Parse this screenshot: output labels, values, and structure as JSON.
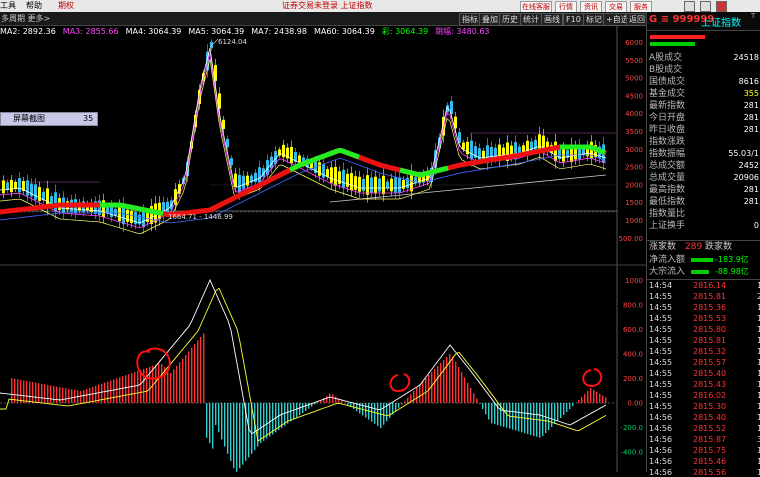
{
  "menubar": {
    "items": [
      {
        "label": "工具",
        "red": false
      },
      {
        "label": "帮助",
        "red": false
      },
      {
        "label": "期权",
        "red": true
      }
    ],
    "notice": "证券交易未登录 上证指数",
    "buttons": [
      "在线客服",
      "行情",
      "资讯",
      "交易",
      "服务"
    ]
  },
  "toolbar2": {
    "left_label": "多周期  更多>",
    "buttons": [
      "指标",
      "叠加",
      "历史",
      "统计",
      "画线",
      "F10",
      "标记",
      "+自选",
      "返回"
    ]
  },
  "ma_legend": [
    {
      "text": "MA2: 2892.36",
      "color": "#ffffff"
    },
    {
      "text": "MA3: 2855.66",
      "color": "#ff44ff"
    },
    {
      "text": "MA4: 3064.39",
      "color": "#ffffff"
    },
    {
      "text": "MA5: 3064.39",
      "color": "#ffffff"
    },
    {
      "text": "MA7: 2438.98",
      "color": "#ffffff"
    },
    {
      "text": "MA60: 3064.39",
      "color": "#ffffff"
    },
    {
      "text": "彩: 3064.39",
      "color": "#00ff00"
    },
    {
      "text": "跳幅: 3480.63",
      "color": "#ff44ff"
    }
  ],
  "tooltip": {
    "label": "屏幕截图",
    "value": "35"
  },
  "annotations": {
    "high": "6124.04",
    "low": "1664.71 - 1446.99"
  },
  "price_axis": [
    "6000",
    "5500",
    "5000",
    "4500",
    "4000",
    "3500",
    "3000",
    "2500",
    "2000",
    "1500",
    "1000",
    "500.00"
  ],
  "macd_axis": [
    "1000",
    "800.0",
    "600.0",
    "400.0",
    "200.0",
    "0.00",
    "-200.0",
    "-400.0"
  ],
  "right_panel": {
    "code": "G ≡ 999999",
    "name": "上证指数",
    "name_sup": "T",
    "stats": [
      {
        "label": "A股成交",
        "value": "24518",
        "color": "#ffffff"
      },
      {
        "label": "B股成交",
        "value": "",
        "color": "#ffffff"
      },
      {
        "label": "国债成交",
        "value": "8616",
        "color": "#ffffff"
      },
      {
        "label": "基金成交",
        "value": "355",
        "color": "#ffff00"
      },
      {
        "label": "最新指数",
        "value": "281",
        "color": "#ffffff"
      },
      {
        "label": "今日开盘",
        "value": "281",
        "color": "#ffffff"
      },
      {
        "label": "昨日收盘",
        "value": "281",
        "color": "#ffffff"
      },
      {
        "label": "指数涨跌",
        "value": "",
        "color": "#ffffff"
      },
      {
        "label": "指数振幅",
        "value": "55.03/1",
        "color": "#ffffff"
      },
      {
        "label": "总成交额",
        "value": "2452",
        "color": "#ffffff"
      },
      {
        "label": "总成交量",
        "value": "20906",
        "color": "#ffffff"
      },
      {
        "label": "最高指数",
        "value": "281",
        "color": "#ffffff"
      },
      {
        "label": "最低指数",
        "value": "281",
        "color": "#ffffff"
      },
      {
        "label": "指数量比",
        "value": "",
        "color": "#ffffff"
      },
      {
        "label": "上证换手",
        "value": "0",
        "color": "#ffffff"
      }
    ],
    "rise_label": "涨家数",
    "rise_count": "289",
    "fall_label": "跌家数",
    "inflow_label": "净流入额",
    "inflow_value": "-183.9亿",
    "block_label": "大宗流入",
    "block_value": "-88.98亿",
    "ticks": [
      {
        "time": "14:54",
        "price": "2816.14",
        "extra": "1."
      },
      {
        "time": "14:55",
        "price": "2815.81",
        "extra": "2."
      },
      {
        "time": "14:55",
        "price": "2815.36",
        "extra": "1."
      },
      {
        "time": "14:55",
        "price": "2815.53",
        "extra": "1."
      },
      {
        "time": "14:55",
        "price": "2815.80",
        "extra": "1."
      },
      {
        "time": "14:55",
        "price": "2815.81",
        "extra": "1."
      },
      {
        "time": "14:55",
        "price": "2815.32",
        "extra": "1."
      },
      {
        "time": "14:55",
        "price": "2815.57",
        "extra": "1."
      },
      {
        "time": "14:55",
        "price": "2815.40",
        "extra": "1."
      },
      {
        "time": "14:55",
        "price": "2815.43",
        "extra": "1."
      },
      {
        "time": "14:55",
        "price": "2816.02",
        "extra": "1."
      },
      {
        "time": "14:55",
        "price": "2815.30",
        "extra": "1."
      },
      {
        "time": "14:56",
        "price": "2815.40",
        "extra": "1."
      },
      {
        "time": "14:56",
        "price": "2815.52",
        "extra": "1."
      },
      {
        "time": "14:56",
        "price": "2815.87",
        "extra": "3."
      },
      {
        "time": "14:56",
        "price": "2815.75",
        "extra": "1."
      },
      {
        "time": "14:56",
        "price": "2815.46",
        "extra": "1."
      },
      {
        "time": "14:56",
        "price": "2815.56",
        "extra": "1."
      }
    ]
  }
}
